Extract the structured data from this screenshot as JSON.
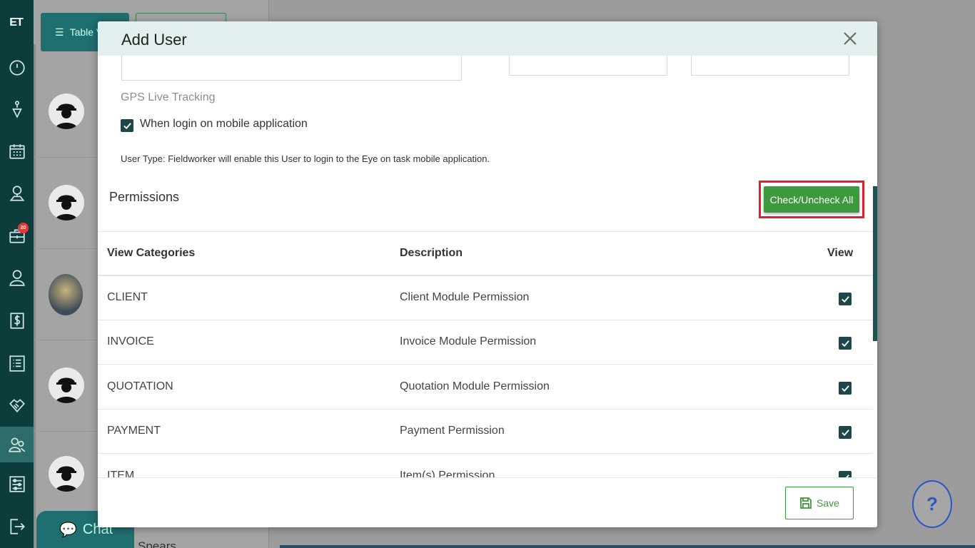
{
  "sidebar": {
    "logo": "ET",
    "badge_count": "20",
    "items": [
      {
        "icon": "dashboard-icon"
      },
      {
        "icon": "pin-tool-icon"
      },
      {
        "icon": "calendar-icon"
      },
      {
        "icon": "map-location-icon"
      },
      {
        "icon": "briefcase-icon"
      },
      {
        "icon": "person-icon"
      },
      {
        "icon": "dollar-icon"
      },
      {
        "icon": "list-icon"
      },
      {
        "icon": "handshake-icon"
      },
      {
        "icon": "users-icon"
      },
      {
        "icon": "settings-sliders-icon"
      },
      {
        "icon": "logout-icon"
      }
    ]
  },
  "background": {
    "table_view_label": "Table V",
    "last_user_name": "Spears",
    "chat_label": "Chat",
    "help_label": "?"
  },
  "modal": {
    "title": "Add User",
    "gps_label": "GPS Live Tracking",
    "mobile_checkbox_label": "When login on mobile application",
    "mobile_checkbox_checked": true,
    "info_text": "User Type: Fieldworker will enable this User to login to the Eye on task mobile application.",
    "permissions_title": "Permissions",
    "check_all_label": "Check/Uncheck All",
    "table": {
      "headers": [
        "View Categories",
        "Description",
        "View"
      ],
      "rows": [
        {
          "category": "CLIENT",
          "description": "Client Module Permission",
          "view": true
        },
        {
          "category": "INVOICE",
          "description": "Invoice Module Permission",
          "view": true
        },
        {
          "category": "QUOTATION",
          "description": "Quotation Module Permission",
          "view": true
        },
        {
          "category": "PAYMENT",
          "description": "Payment Permission",
          "view": true
        },
        {
          "category": "ITEM",
          "description": "Item(s) Permission",
          "view": true
        }
      ]
    },
    "save_label": "Save"
  },
  "colors": {
    "sidebar": "#0d3c3c",
    "primary_green": "#3c9a3c",
    "highlight_red": "#e0202a",
    "checkbox": "#1e4848"
  }
}
